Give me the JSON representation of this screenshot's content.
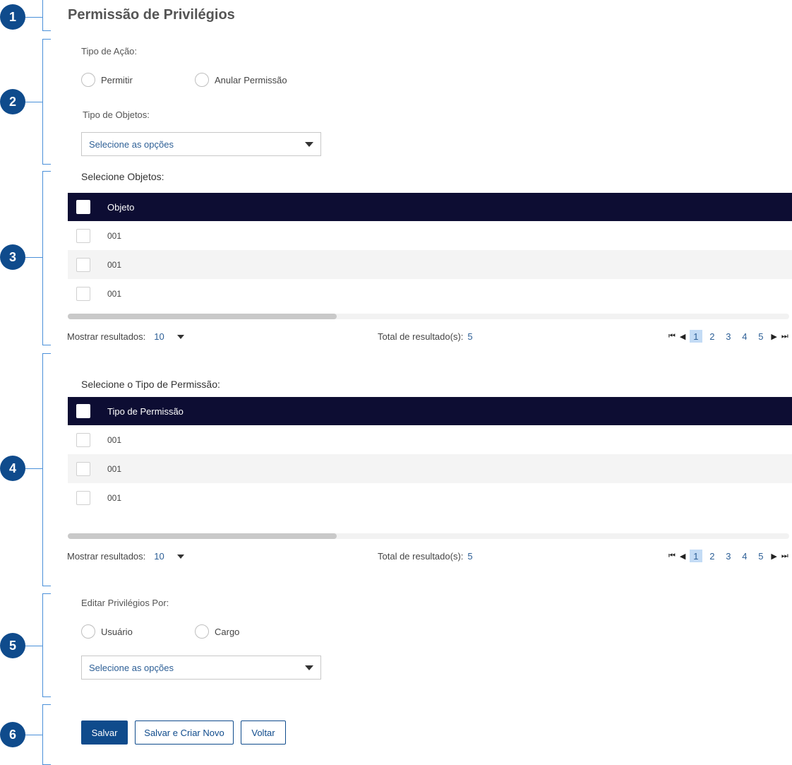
{
  "colors": {
    "accent": "#0f4b8c",
    "header_bg": "#0d0d33",
    "link": "#2d5f96",
    "marker_line": "#4a90d9"
  },
  "markers": [
    "1",
    "2",
    "3",
    "4",
    "5",
    "6"
  ],
  "page_title": "Permissão de Privilégios",
  "action": {
    "label": "Tipo de Ação:",
    "options": [
      "Permitir",
      "Anular Permissão"
    ]
  },
  "object_type": {
    "label": "Tipo de Objetos:",
    "placeholder": "Selecione as opções"
  },
  "objects_table": {
    "label": "Selecione Objetos:",
    "header": "Objeto",
    "rows": [
      "001",
      "001",
      "001"
    ],
    "show_label": "Mostrar resultados:",
    "page_size": "10",
    "total_label": "Total de resultado(s):",
    "total": "5",
    "pages": [
      "1",
      "2",
      "3",
      "4",
      "5"
    ],
    "current_page": "1"
  },
  "permission_table": {
    "label": "Selecione o Tipo de Permissão:",
    "header": "Tipo de Permissão",
    "rows": [
      "001",
      "001",
      "001"
    ],
    "show_label": "Mostrar resultados:",
    "page_size": "10",
    "total_label": "Total de resultado(s):",
    "total": "5",
    "pages": [
      "1",
      "2",
      "3",
      "4",
      "5"
    ],
    "current_page": "1"
  },
  "edit_by": {
    "label": "Editar Privilégios Por:",
    "options": [
      "Usuário",
      "Cargo"
    ],
    "placeholder": "Selecione as opções"
  },
  "buttons": {
    "save": "Salvar",
    "save_new": "Salvar e Criar Novo",
    "back": "Voltar"
  },
  "icons": [
    "pager-first-icon",
    "pager-prev-icon",
    "pager-next-icon",
    "pager-last-icon",
    "dropdown-caret-icon"
  ]
}
